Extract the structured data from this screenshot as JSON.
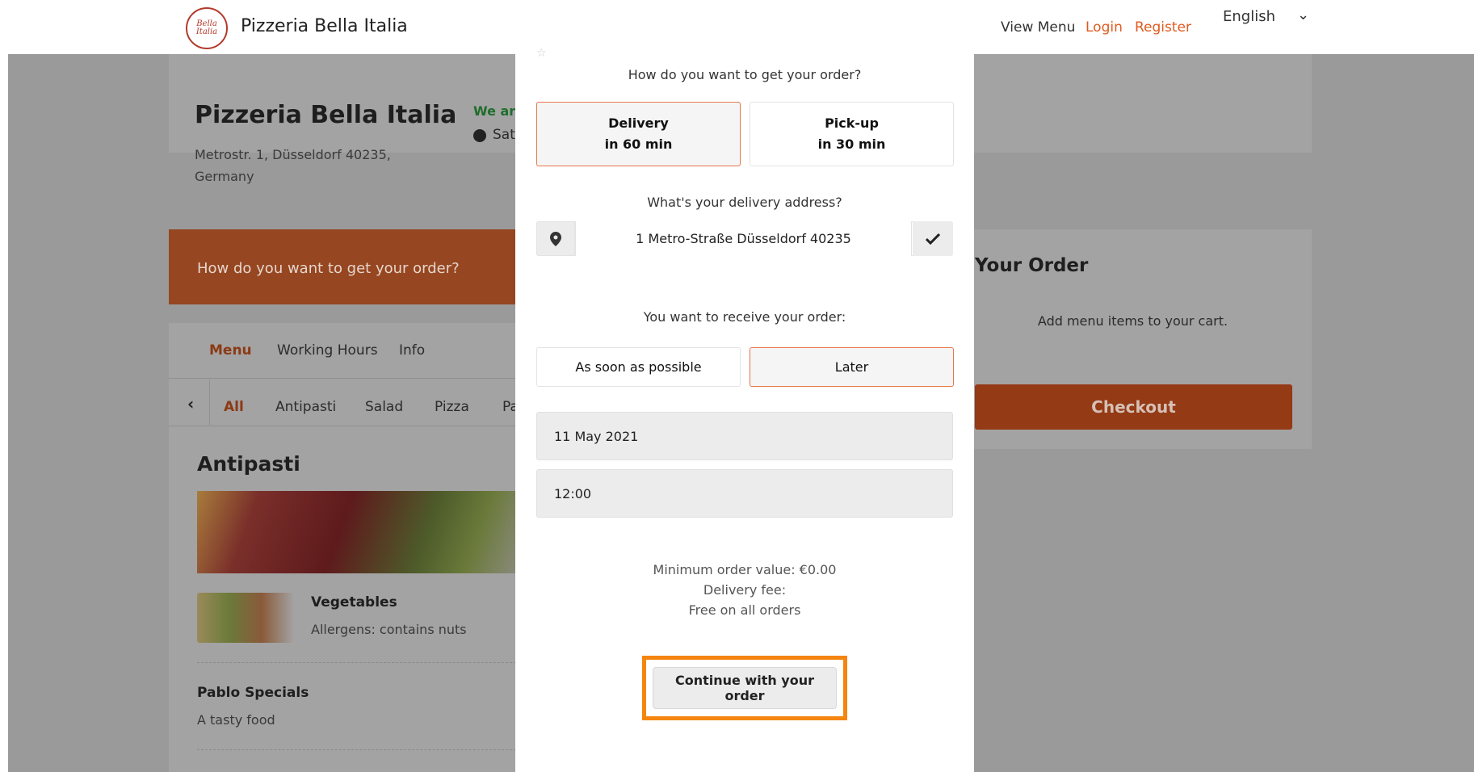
{
  "header": {
    "logo_text": "Bella Italia",
    "brand": "Pizzeria Bella Italia",
    "nav": {
      "view_menu": "View Menu",
      "login": "Login",
      "register": "Register"
    },
    "language": "English",
    "accent_color": "#e05a1e"
  },
  "restaurant": {
    "name": "Pizzeria Bella Italia",
    "address": "Metrostr. 1, Düsseldorf 40235, Germany",
    "open_status": "We are",
    "hours_partial": "Sat"
  },
  "banner": {
    "text": "How do you want to get your order?"
  },
  "menu": {
    "tabs": [
      "Menu",
      "Working Hours",
      "Info"
    ],
    "categories": [
      "All",
      "Antipasti",
      "Salad",
      "Pizza",
      "Pa"
    ],
    "section_title": "Antipasti",
    "items": [
      {
        "name": "Vegetables",
        "detail": "Allergens: contains nuts"
      },
      {
        "name": "Pablo Specials",
        "detail": "A tasty food"
      }
    ]
  },
  "cart": {
    "title": "Your Order",
    "empty_text": "Add menu items to your cart.",
    "checkout_label": "Checkout"
  },
  "modal": {
    "question_method": "How do you want to get your order?",
    "options": [
      {
        "label": "Delivery",
        "sub": "in 60 min",
        "selected": true
      },
      {
        "label": "Pick-up",
        "sub": "in 30 min",
        "selected": false
      }
    ],
    "question_address": "What's your delivery address?",
    "address_value": "1 Metro-Straße Düsseldorf 40235",
    "question_time": "You want to receive your order:",
    "time_options": [
      "As soon as possible",
      "Later"
    ],
    "time_selected": "Later",
    "date_value": "11 May 2021",
    "time_value": "12:00",
    "min_order": "Minimum order value: €0.00",
    "delivery_fee_label": "Delivery fee:",
    "delivery_fee_value": "Free on all orders",
    "continue_label": "Continue with your order",
    "highlight_color": "#f5850f"
  }
}
